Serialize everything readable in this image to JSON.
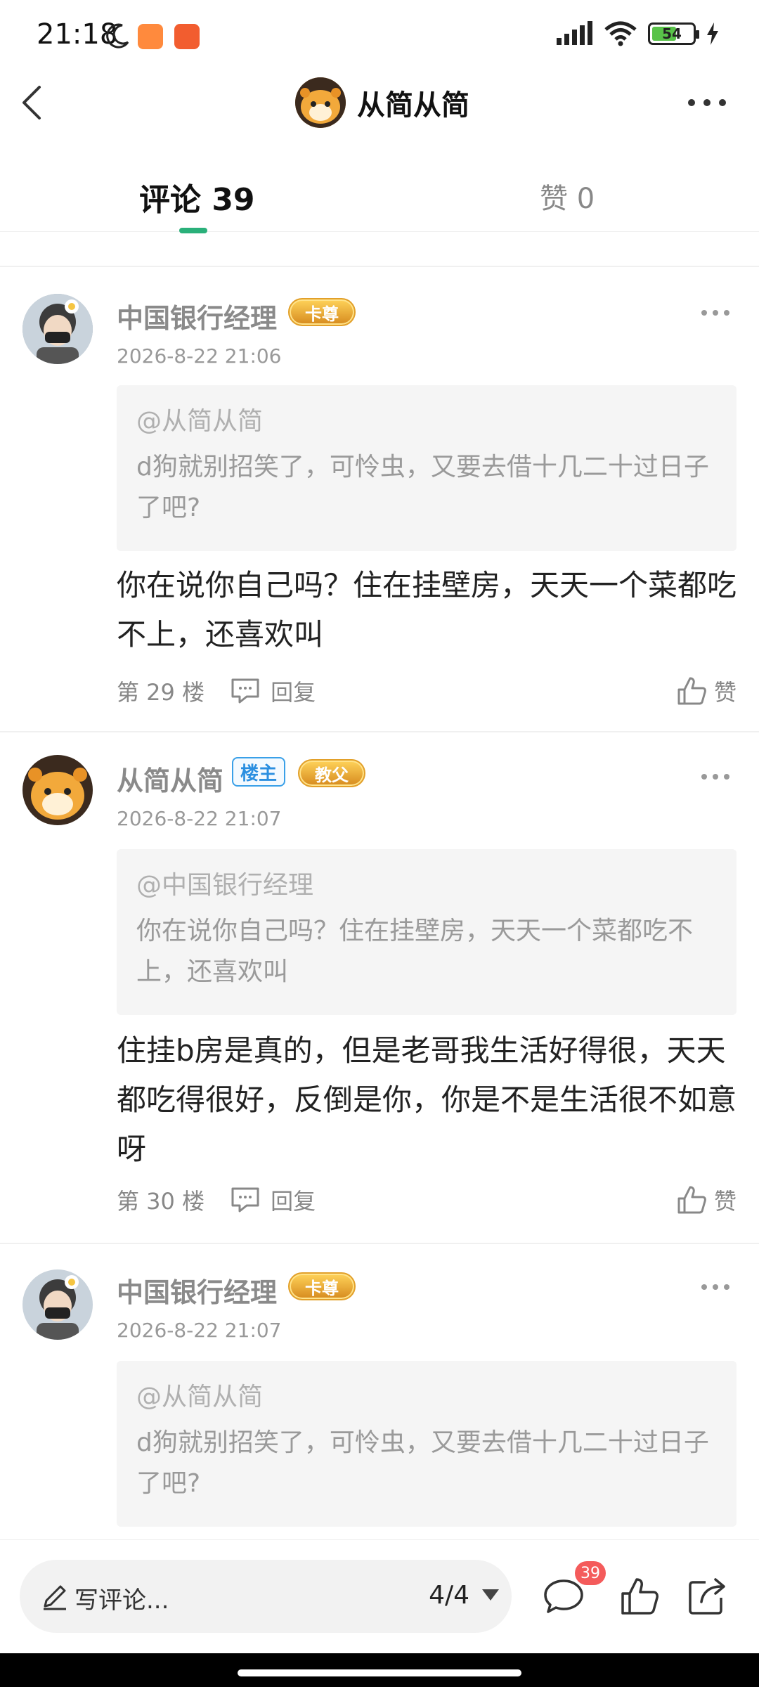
{
  "status": {
    "time": "21:18",
    "battery": "54"
  },
  "header": {
    "title": "从简从简"
  },
  "tabs": {
    "comments_label": "评论 39",
    "likes_label": "赞 0"
  },
  "comments": [
    {
      "name": "中国银行经理",
      "badges": [
        "卡尊"
      ],
      "time": "2026-8-22 21:06",
      "quote_user": "@从简从简",
      "quote_text": "d狗就别招笑了，可怜虫，又要去借十几二十过日子了吧?",
      "content": "你在说你自己吗？住在挂壁房，天天一个菜都吃不上，还喜欢叫",
      "floor": "第 29 楼",
      "reply": "回复",
      "like": "赞"
    },
    {
      "name": "从简从简",
      "owner_badge": "楼主",
      "badges": [
        "教父"
      ],
      "time": "2026-8-22 21:07",
      "quote_user": "@中国银行经理",
      "quote_text": "你在说你自己吗？住在挂壁房，天天一个菜都吃不上，还喜欢叫",
      "content": "住挂b房是真的，但是老哥我生活好得很，天天都吃得很好，反倒是你，你是不是生活很不如意呀",
      "floor": "第 30 楼",
      "reply": "回复",
      "like": "赞"
    },
    {
      "name": "中国银行经理",
      "badges": [
        "卡尊"
      ],
      "time": "2026-8-22 21:07",
      "quote_user": "@从简从简",
      "quote_text": "d狗就别招笑了，可怜虫，又要去借十几二十过日子了吧?"
    }
  ],
  "bottom": {
    "input_label": "写评论...",
    "page": "4/4",
    "comment_count": "39"
  },
  "colors": {
    "accent": "#2ab07a",
    "owner_badge": "#2b8fe0",
    "count_badge": "#f45b5b"
  },
  "icons": [
    "back-icon",
    "more-icon",
    "reply-icon",
    "like-icon",
    "pencil-icon",
    "comment-icon",
    "share-icon"
  ]
}
